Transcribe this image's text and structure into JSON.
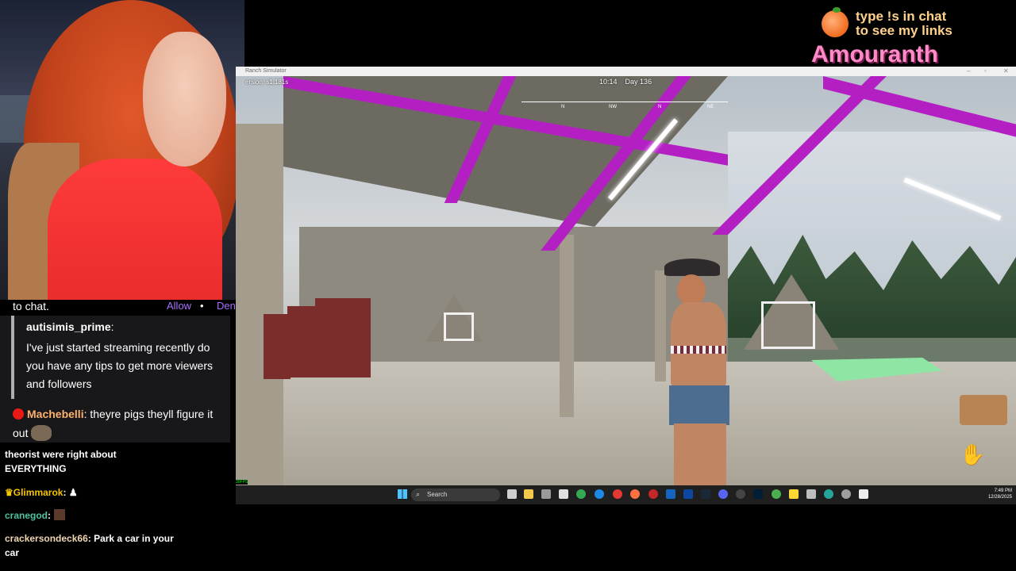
{
  "overlay": {
    "line1": "type !s in chat",
    "line2": "to see my links",
    "brand": "Amouranth"
  },
  "chat": {
    "top_text": "to chat.",
    "allow_label": "Allow",
    "separator": "•",
    "deny_label": "Deny",
    "reply": {
      "user": "autisimis_prime",
      "colon": ":",
      "message": "I've just started streaming recently do you have any tips to get more viewers and followers"
    },
    "highlight": {
      "user": "Machebelli",
      "message": ": theyre pigs theyll figure it out"
    },
    "messages": [
      {
        "user": "",
        "text": "theorist were right about EVERYTHING"
      },
      {
        "user": "Glimmarok",
        "text": ":"
      },
      {
        "user": "cranegod",
        "text": ":"
      },
      {
        "user": "crackersondeck66",
        "text": ": Park a car in your car"
      }
    ],
    "colors": {
      "glimmarok": "#f5c400",
      "cranegod": "#4fc3a1",
      "crackersondeck66": "#f2d6b3"
    }
  },
  "game": {
    "window_title": "Ranch Simulator",
    "version": "ersion: s1.181s",
    "time": "10:14",
    "day": "Day 136",
    "compass": [
      "N",
      "NW",
      "N",
      "NE"
    ],
    "fps": "30FPS"
  },
  "taskbar": {
    "search_placeholder": "Search",
    "time": "7:49 PM",
    "date": "12/28/2025"
  },
  "colors": {
    "accent": "#a970ff",
    "magenta_beam": "#b41fc4",
    "brand_pink": "#ff8ac8"
  }
}
